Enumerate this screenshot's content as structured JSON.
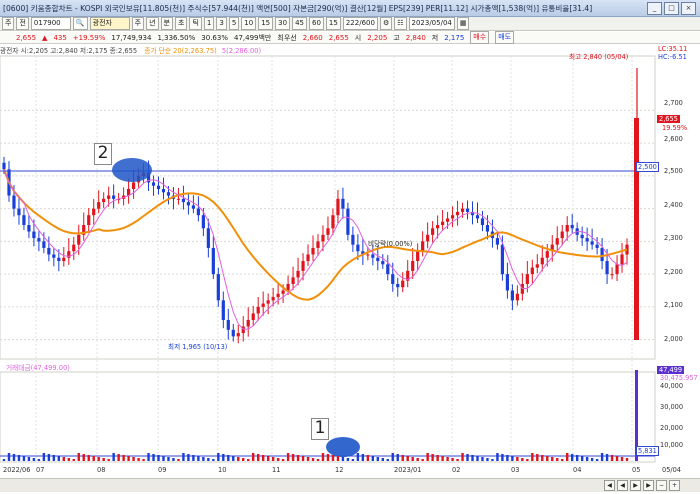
{
  "window": {
    "title": "[0600] 키움종합차트 - KOSPI 외국인보유[11.805(천)] 주식수[57.944(천)] 액면[500] 자본금[290(억)] 결산[12월] EPS[239] PER[11.12] 시가총액[1,538(억)] 유통비율[31.4]",
    "buttons": [
      "_",
      "□",
      "×"
    ]
  },
  "toolbar": {
    "menu": "주",
    "sub": "전",
    "code": "017900",
    "name": "광전자",
    "periods": [
      "주",
      "년",
      "분",
      "초",
      "틱"
    ],
    "numbers": [
      "1",
      "3",
      "5",
      "10",
      "15",
      "30",
      "45",
      "60",
      "15"
    ],
    "count": "222",
    "count_total": "600",
    "date": "2023/05/04"
  },
  "quote": {
    "price": "2,655",
    "change": "435",
    "change_pct": "+19.59%",
    "volume": "17,749,934",
    "vol_pct": "1,336.50%",
    "turnover": "30.63%",
    "amount": "47,499백만",
    "min_sell": "최우선",
    "min_sell_val": "2,660",
    "min_buy_val": "2,655",
    "open_label": "시",
    "open": "2,205",
    "high_label": "고",
    "high": "2,840",
    "low_label": "저",
    "low": "2,175",
    "sell_btn": "매수",
    "buy_btn": "매도"
  },
  "legend": {
    "price": "광전자 시:2,205 고:2,840 저:2,175 종:2,655",
    "ma20": "종가 단순 20(2,263.75)",
    "ma5": "5(2,286.00)"
  },
  "volume_legend": "거래대금(47,499.00)",
  "price_axis": {
    "ticks": [
      "2,700",
      "2,600",
      "2,500",
      "2,400",
      "2,300",
      "2,200",
      "2,100",
      "2,000"
    ],
    "lc": "LC:35.11",
    "hc": "HC:-6.51",
    "last": "2,655",
    "last_pct": "19.59%",
    "line": "2,500"
  },
  "volume_axis": {
    "ticks": [
      "40,000",
      "30,000",
      "20,000",
      "10,000"
    ],
    "last": "47,499",
    "last2": "30,475.957",
    "line": "5,831"
  },
  "x_axis": [
    "2022/06",
    "07",
    "08",
    "09",
    "10",
    "11",
    "12",
    "2023/01",
    "02",
    "03",
    "04",
    "05",
    "05/04"
  ],
  "annotations": {
    "high": "최고 2,840 (05/04)",
    "low": "최저 1,965 (10/13)",
    "mid": "비당락(0.00%)",
    "box1": "1",
    "box2": "2"
  },
  "colors": {
    "up": "#e0141e",
    "down": "#1a3fd8",
    "ma20": "#f0900a",
    "ma5": "#e060e0",
    "ellipse": "#1e56c8"
  },
  "chart_data": {
    "type": "candlestick",
    "ylim": [
      1950,
      2860
    ],
    "closes": [
      2520,
      2440,
      2400,
      2380,
      2350,
      2330,
      2310,
      2300,
      2280,
      2260,
      2250,
      2240,
      2250,
      2270,
      2290,
      2320,
      2350,
      2380,
      2400,
      2420,
      2430,
      2440,
      2430,
      2430,
      2440,
      2460,
      2480,
      2500,
      2510,
      2480,
      2470,
      2460,
      2450,
      2440,
      2430,
      2430,
      2420,
      2410,
      2400,
      2380,
      2340,
      2280,
      2200,
      2120,
      2060,
      2030,
      2010,
      2020,
      2040,
      2060,
      2080,
      2100,
      2110,
      2120,
      2130,
      2140,
      2150,
      2170,
      2190,
      2210,
      2240,
      2260,
      2280,
      2300,
      2320,
      2340,
      2380,
      2430,
      2400,
      2320,
      2290,
      2270,
      2260,
      2260,
      2250,
      2240,
      2230,
      2200,
      2170,
      2160,
      2180,
      2210,
      2240,
      2270,
      2300,
      2320,
      2340,
      2350,
      2360,
      2370,
      2380,
      2390,
      2400,
      2390,
      2380,
      2370,
      2350,
      2330,
      2310,
      2290,
      2200,
      2150,
      2120,
      2140,
      2170,
      2200,
      2220,
      2230,
      2250,
      2270,
      2290,
      2310,
      2330,
      2350,
      2340,
      2320,
      2310,
      2300,
      2290,
      2280,
      2240,
      2200,
      2200,
      2230,
      2260,
      2290,
      2655
    ]
  }
}
